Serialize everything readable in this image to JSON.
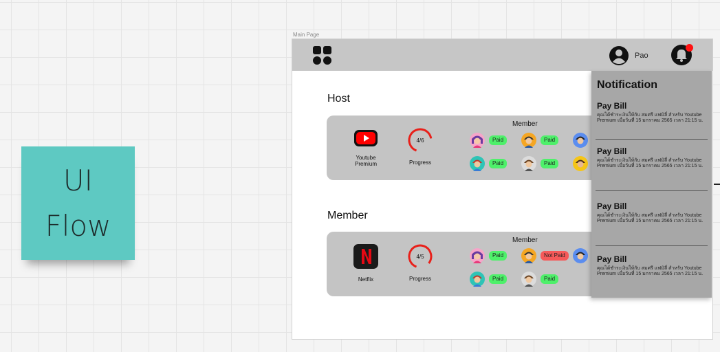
{
  "sticky": {
    "text": "UI\nFlow",
    "color": "#5ec9c2"
  },
  "frame": {
    "label": "Main Page"
  },
  "header": {
    "user_name": "Pao"
  },
  "host": {
    "title": "Host",
    "service": {
      "name": "Youtube\nPremium",
      "icon": "youtube-icon"
    },
    "progress": {
      "text": "4/6",
      "current": 4,
      "total": 6,
      "label": "Progress"
    },
    "member_heading": "Member",
    "members": [
      {
        "status": "Paid",
        "state": "paid"
      },
      {
        "status": "Paid",
        "state": "paid"
      },
      {
        "status": "Paid",
        "state": "paid"
      },
      {
        "status": "Paid",
        "state": "paid"
      }
    ]
  },
  "member": {
    "title": "Member",
    "service": {
      "name": "Netflix",
      "icon": "netflix-icon"
    },
    "progress": {
      "text": "4/5",
      "current": 4,
      "total": 5,
      "label": "Progress"
    },
    "member_heading": "Member",
    "members": [
      {
        "status": "Paid",
        "state": "paid"
      },
      {
        "status": "Not Paid",
        "state": "unpaid"
      },
      {
        "status": "Paid",
        "state": "paid"
      },
      {
        "status": "Paid",
        "state": "paid"
      }
    ]
  },
  "notification": {
    "title": "Notification",
    "items": [
      {
        "title": "Pay Bill",
        "body": "คุณได้ชำระเงินให้กับ สมศรี แฟมิลี่ สำหรับ Youtube Premium เมื่อวันที่ 15 มกราคม 2565 เวลา 21:15 น."
      },
      {
        "title": "Pay Bill",
        "body": "คุณได้ชำระเงินให้กับ สมศรี แฟมิลี่ สำหรับ Youtube Premium เมื่อวันที่ 15 มกราคม 2565 เวลา 21:15 น."
      },
      {
        "title": "Pay Bill",
        "body": "คุณได้ชำระเงินให้กับ สมศรี แฟมิลี่ สำหรับ Youtube Premium เมื่อวันที่ 15 มกราคม 2565 เวลา 21:15 น."
      },
      {
        "title": "Pay Bill",
        "body": "คุณได้ชำระเงินให้กับ สมศรี แฟมิลี่ สำหรับ Youtube Premium เมื่อวันที่ 15 มกราคม 2565 เวลา 21:15 น."
      }
    ]
  },
  "colors": {
    "paid": "#4ef06a",
    "not_paid": "#f55959",
    "progress_ring": "#e8201a",
    "notification_dot": "#ff1111"
  }
}
